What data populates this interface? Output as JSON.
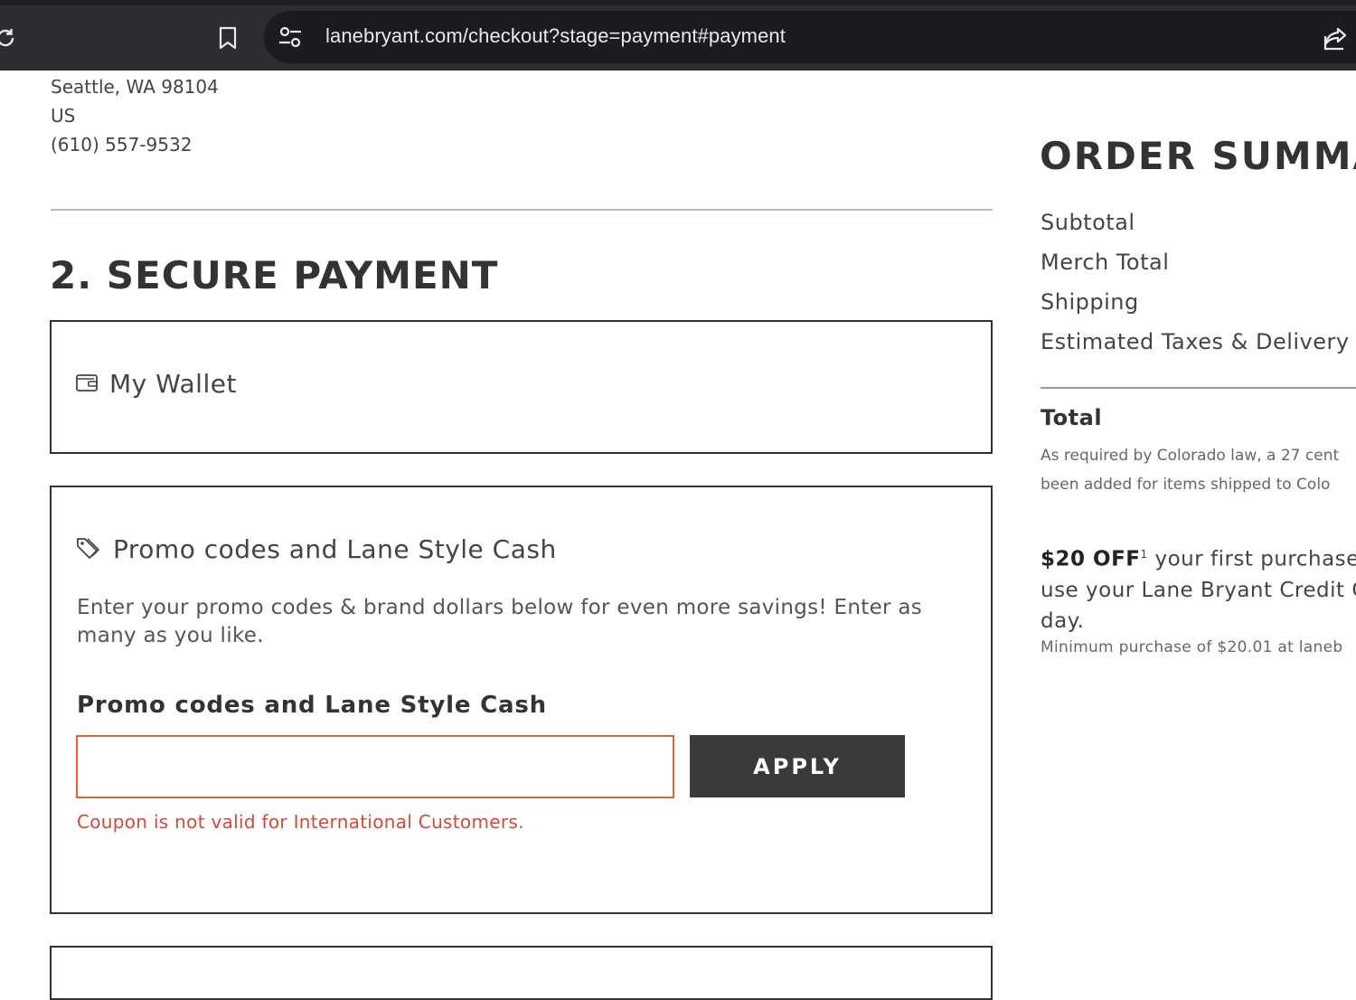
{
  "browser": {
    "url": "lanebryant.com/checkout?stage=payment#payment",
    "icons": [
      "reload-icon",
      "bookmark-icon",
      "site-settings-icon",
      "share-icon"
    ]
  },
  "shipping_address": {
    "city_line": "Seattle, WA 98104",
    "country": "US",
    "phone": "(610) 557-9532"
  },
  "payment": {
    "section_title": "2. SECURE PAYMENT",
    "wallet": {
      "label": "My Wallet",
      "icon": "wallet-icon"
    },
    "promo": {
      "heading": "Promo codes and Lane Style Cash",
      "heading_icon": "tag-icon",
      "description": "Enter your promo codes & brand dollars below for even more savings! Enter as many as you like.",
      "field_label": "Promo codes and Lane Style Cash",
      "input_value": "",
      "input_placeholder": "",
      "apply_label": "APPLY",
      "error": "Coupon is not valid for International Customers."
    }
  },
  "order_summary": {
    "title": "ORDER SUMMA",
    "rows": [
      "Subtotal",
      "Merch Total",
      "Shipping",
      "Estimated Taxes & Delivery"
    ],
    "total_label": "Total",
    "legal_line1": "As required by Colorado law, a 27 cent",
    "legal_line2": "been added for items shipped to Colo",
    "offer_strong": "$20 OFF",
    "offer_sup": "1",
    "offer_line1_rest": " your first purchase w",
    "offer_line2": "use your Lane Bryant Credit C",
    "offer_line3": "day.",
    "offer_fine": "Minimum purchase of $20.01 at laneb"
  },
  "colors": {
    "error": "#d2493a",
    "input_error_border": "#e0623e",
    "button_bg": "#3a3a3a",
    "chrome_bg": "#2b2d31"
  }
}
